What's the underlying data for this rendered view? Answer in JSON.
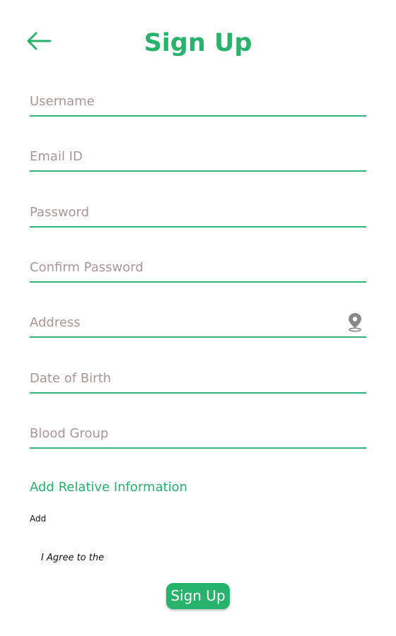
{
  "header": {
    "back_icon": "arrow-left-icon",
    "title": "Sign Up"
  },
  "form": {
    "fields": [
      {
        "placeholder": "Username",
        "value": ""
      },
      {
        "placeholder": "Email ID",
        "value": ""
      },
      {
        "placeholder": "Password",
        "value": ""
      },
      {
        "placeholder": "Confirm Password",
        "value": ""
      },
      {
        "placeholder": "Address",
        "value": "",
        "icon": "location-pin-icon"
      },
      {
        "placeholder": "Date of Birth",
        "value": ""
      },
      {
        "placeholder": "Blood Group",
        "value": ""
      }
    ],
    "relative_section_label": "Add Relative Information",
    "add_label": "Add",
    "agree_text": "I Agree to the",
    "submit_label": "Sign Up"
  },
  "colors": {
    "accent": "#27b36b",
    "underline": "#2fb57a",
    "placeholder": "#a89596",
    "icon_gray": "#888888"
  }
}
